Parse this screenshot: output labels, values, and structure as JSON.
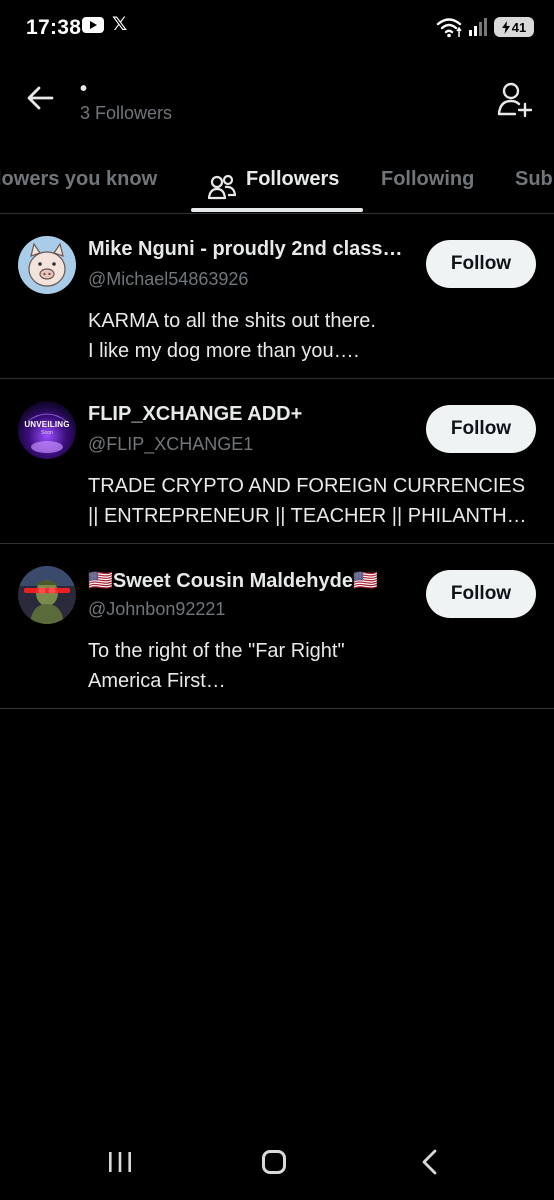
{
  "status_bar": {
    "time": "17:38",
    "x_glyph": "𝕏",
    "battery_level": "41",
    "icons": [
      "youtube-icon",
      "x-icon",
      "wifi-icon",
      "signal-icon",
      "battery-charging-icon"
    ]
  },
  "header": {
    "title": "•",
    "subtitle": "3 Followers"
  },
  "tabs": [
    {
      "label": "lowers you know"
    },
    {
      "label": "Followers",
      "active": true
    },
    {
      "label": "Following"
    },
    {
      "label": "Sub"
    }
  ],
  "followers": [
    {
      "name": "Mike Nguni - proudly 2nd class…",
      "handle": "@Michael54863926",
      "bio": [
        "KARMA to all the shits out there.",
        "I like my dog more than you…."
      ],
      "button": "Follow",
      "avatar_icon": "pig-avatar-icon"
    },
    {
      "name": "FLIP_XCHANGE ADD+",
      "handle": "@FLIP_XCHANGE1",
      "bio": [
        "TRADE CRYPTO AND FOREIGN CURRENCIES",
        "|| ENTREPRENEUR || TEACHER || PHILANTHR…"
      ],
      "button": "Follow",
      "avatar_icon": "unveiling-avatar-icon",
      "avatar_text": "UNVEILING",
      "avatar_subtext": "Soon"
    },
    {
      "name": "🇺🇸Sweet Cousin Maldehyde🇺🇸",
      "handle": "@Johnbon92221",
      "bio": [
        "To the right of the \"Far Right\"",
        "America First…"
      ],
      "button": "Follow",
      "avatar_icon": "laser-eyes-avatar-icon"
    }
  ],
  "colors": {
    "background": "#000000",
    "text_primary": "#e7e9ea",
    "text_secondary": "#71767b",
    "divider": "#2f3336",
    "button_bg": "#eff3f4"
  }
}
